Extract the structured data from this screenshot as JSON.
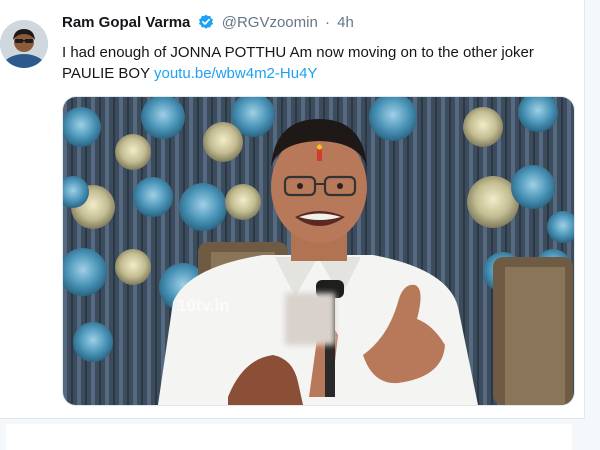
{
  "tweet": {
    "author_name": "Ram Gopal Varma",
    "handle": "@RGVzoomin",
    "separator": "·",
    "time": "4h",
    "text": "I had enough of JONNA POTTHU Am now moving on to the other joker PAULIE BOY ",
    "link": "youtu.be/wbw4m2-Hu4Y"
  },
  "media": {
    "watermark": "10tv.in"
  },
  "icons": {
    "verified": "verified-badge-icon"
  },
  "colors": {
    "link": "#1da1f2",
    "verified": "#1da1f2",
    "handle": "#657786"
  }
}
